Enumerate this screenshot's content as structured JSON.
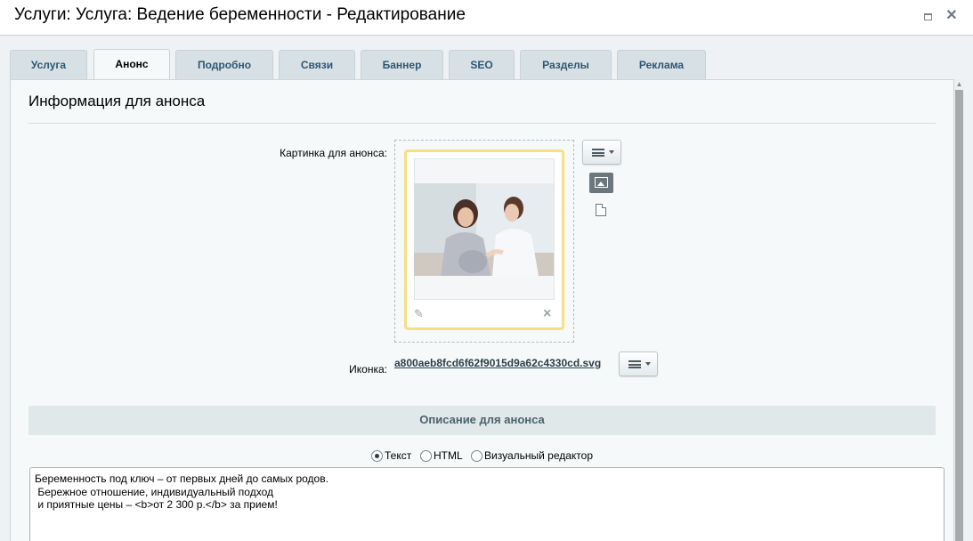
{
  "window": {
    "title": "Услуги: Услуга: Ведение беременности - Редактирование",
    "maximize_icon": "maximize-icon",
    "close_glyph": "✕"
  },
  "tabs": [
    {
      "label": "Услуга",
      "active": false
    },
    {
      "label": "Анонс",
      "active": true
    },
    {
      "label": "Подробно",
      "active": false
    },
    {
      "label": "Связи",
      "active": false
    },
    {
      "label": "Баннер",
      "active": false
    },
    {
      "label": "SEO",
      "active": false
    },
    {
      "label": "Разделы",
      "active": false
    },
    {
      "label": "Реклама",
      "active": false
    }
  ],
  "announce": {
    "section_title": "Информация для анонса",
    "picture_label": "Картинка для анонса:",
    "picture_edit_icon": "pencil-icon",
    "picture_delete_icon": "close-icon",
    "icon_label": "Иконка:",
    "icon_file": "a800aeb8fcd6f62f9015d9a62c4330cd.svg",
    "description_header": "Описание для анонса",
    "mode_options": [
      {
        "label": "Текст",
        "checked": true
      },
      {
        "label": "HTML",
        "checked": false
      },
      {
        "label": "Визуальный редактор",
        "checked": false
      }
    ],
    "description_text": "Беременность под ключ – от первых дней до самых родов.\n Бережное отношение, индивидуальный подход\n и приятные цены – <b>от 2 300 р.</b> за прием!"
  },
  "colors": {
    "accent_tab_text": "#2c5775",
    "highlight_border": "#f5e083",
    "panel_bg": "#f5f9f9"
  }
}
